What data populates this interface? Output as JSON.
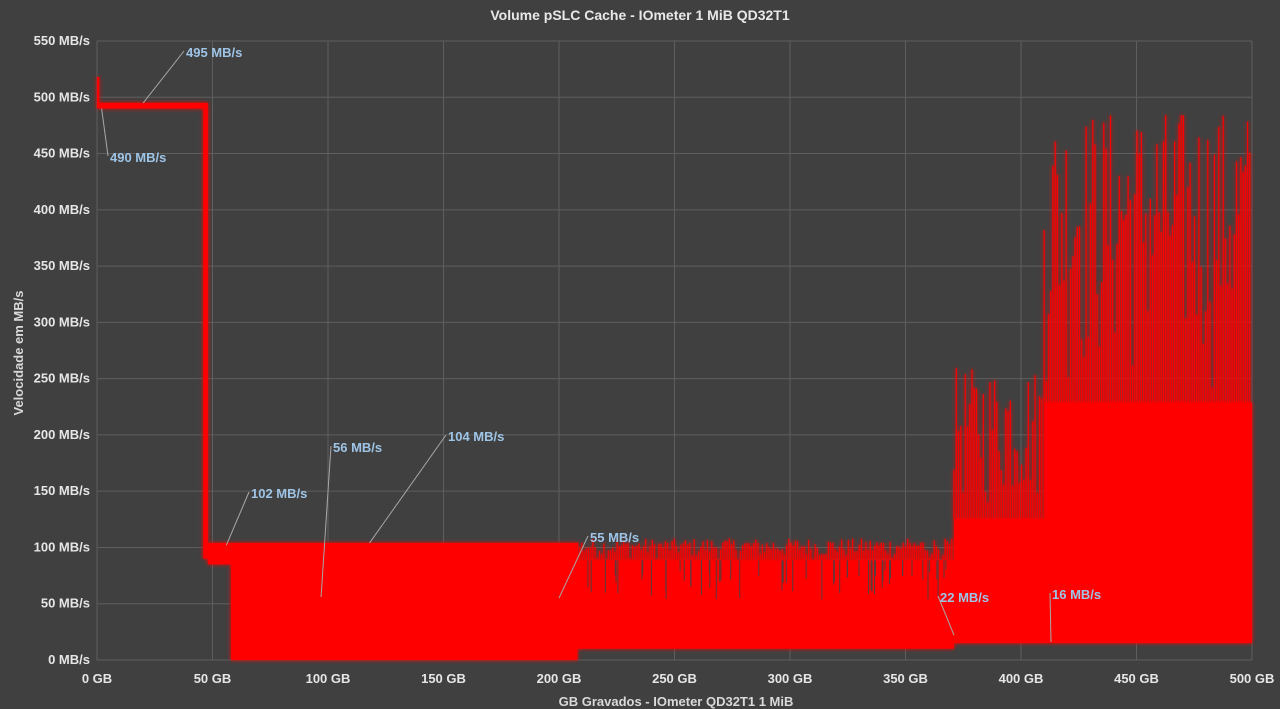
{
  "chart_data": {
    "type": "line",
    "title": "Volume pSLC Cache - IOmeter 1 MiB QD32T1",
    "xlabel": "GB Gravados - IOmeter QD32T1 1 MiB",
    "ylabel": "Velocidade em MB/s",
    "xlim": [
      0,
      500
    ],
    "ylim": [
      0,
      550
    ],
    "x_ticks": [
      "0 GB",
      "50 GB",
      "100 GB",
      "150 GB",
      "200 GB",
      "250 GB",
      "300 GB",
      "350 GB",
      "400 GB",
      "450 GB",
      "500 GB"
    ],
    "y_ticks": [
      "0 MB/s",
      "50 MB/s",
      "100 MB/s",
      "150 MB/s",
      "200 MB/s",
      "250 MB/s",
      "300 MB/s",
      "350 MB/s",
      "400 MB/s",
      "450 MB/s",
      "500 MB/s",
      "550 MB/s"
    ],
    "grid": true,
    "series_color": "#ff0000",
    "segments": [
      {
        "x_start": 0,
        "x_end": 1,
        "low": 490,
        "high": 518
      },
      {
        "x_start": 1,
        "x_end": 46,
        "low": 490,
        "high": 495
      },
      {
        "x_start": 46,
        "x_end": 48,
        "low": 90,
        "high": 495
      },
      {
        "x_start": 48,
        "x_end": 58,
        "low": 85,
        "high": 104
      },
      {
        "x_start": 58,
        "x_end": 160,
        "low": 0,
        "high": 104
      },
      {
        "x_start": 160,
        "x_end": 208,
        "low": 0,
        "high": 104
      },
      {
        "x_start": 208,
        "x_end": 350,
        "low": 10,
        "high": 108
      },
      {
        "x_start": 350,
        "x_end": 371,
        "low": 10,
        "high": 108
      },
      {
        "x_start": 371,
        "x_end": 410,
        "low": 15,
        "high": 260
      },
      {
        "x_start": 410,
        "x_end": 500,
        "low": 15,
        "high": 490
      }
    ],
    "annotations": [
      {
        "text": "495 MB/s",
        "x": 20,
        "y": 495
      },
      {
        "text": "490 MB/s",
        "x": 2,
        "y": 490
      },
      {
        "text": "102 MB/s",
        "x": 56,
        "y": 102
      },
      {
        "text": "56 MB/s",
        "x": 97,
        "y": 56
      },
      {
        "text": "104 MB/s",
        "x": 118,
        "y": 104
      },
      {
        "text": "55 MB/s",
        "x": 200,
        "y": 55
      },
      {
        "text": "22 MB/s",
        "x": 371,
        "y": 22
      },
      {
        "text": "16 MB/s",
        "x": 413,
        "y": 16
      }
    ]
  }
}
